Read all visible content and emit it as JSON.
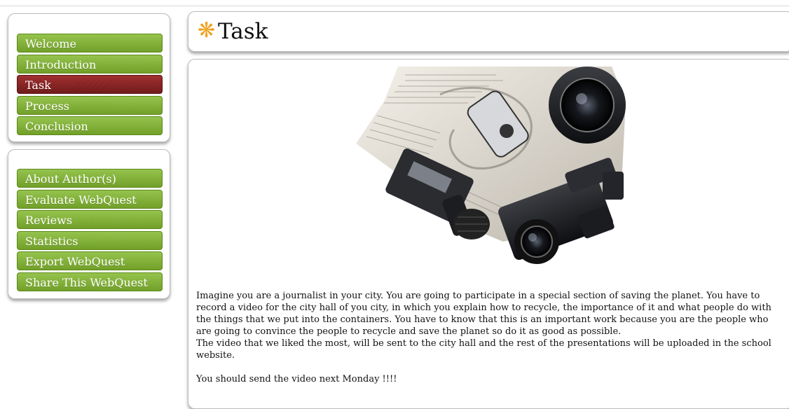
{
  "nav_primary": [
    {
      "label": "Welcome"
    },
    {
      "label": "Introduction"
    },
    {
      "label": "Task"
    },
    {
      "label": "Process"
    },
    {
      "label": "Conclusion"
    }
  ],
  "nav_secondary": [
    {
      "label": "About Author(s)"
    },
    {
      "label": "Evaluate WebQuest"
    },
    {
      "label": "Reviews"
    },
    {
      "label": "Statistics"
    },
    {
      "label": "Export WebQuest"
    },
    {
      "label": "Share This WebQuest"
    }
  ],
  "active_section": "Task",
  "header": {
    "title": "Task",
    "icon": "orange-asterisk-icon"
  },
  "content": {
    "image": "journalism-equipment-illustration",
    "paragraph_1": "Imagine you are a journalist in your city. You are going to participate in a special section of saving the planet. You have to record a video for the city hall of you city, in which you explain how to recycle, the importance of it and what people do with the things that we put into the containers.  You have to know that this is an important work because you are the people who are going to convince the people to recycle and save the planet so do it as good as possible.",
    "paragraph_2": "The video that we liked the most, will be sent to the city hall and the rest of the presentations will be uploaded in the school website.",
    "paragraph_3": "You should send the video next Monday !!!!"
  },
  "colors": {
    "menu_green": "#7aab2f",
    "menu_active_red": "#8b2020",
    "title_asterisk": "#f0a21e"
  }
}
